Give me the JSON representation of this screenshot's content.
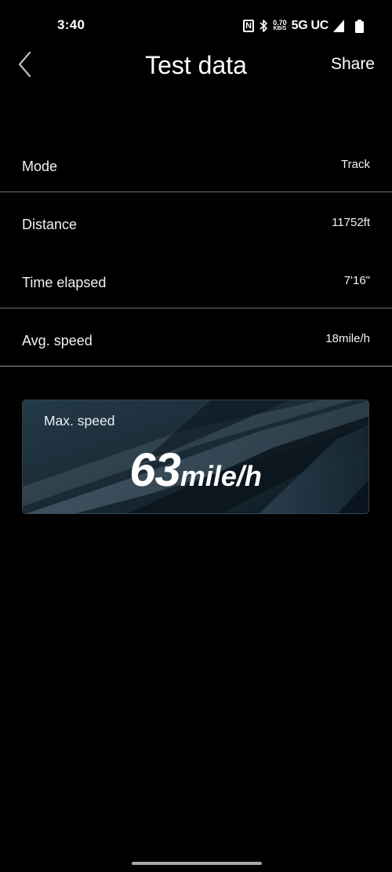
{
  "status_bar": {
    "time": "3:40",
    "nfc_glyph": "N",
    "net_speed_value": "0.70",
    "net_speed_unit": "KB/S",
    "network": "5G UC",
    "icons": [
      "nfc-icon",
      "bluetooth-icon",
      "signal-icon",
      "battery-icon"
    ]
  },
  "header": {
    "title": "Test data",
    "share_label": "Share",
    "back_icon": "chevron-left-icon"
  },
  "rows": [
    {
      "label": "Mode",
      "value": "Track"
    },
    {
      "label": "Distance",
      "value": "11752ft"
    },
    {
      "label": "Time elapsed",
      "value": "7'16\""
    },
    {
      "label": "Avg. speed",
      "value": "18mile/h"
    }
  ],
  "max_speed": {
    "label": "Max. speed",
    "value": "63",
    "unit": "mile/h"
  },
  "colors": {
    "background": "#000000",
    "text": "#ffffff",
    "divider": "#6c6c6c",
    "card_base": "#1b2b36"
  }
}
